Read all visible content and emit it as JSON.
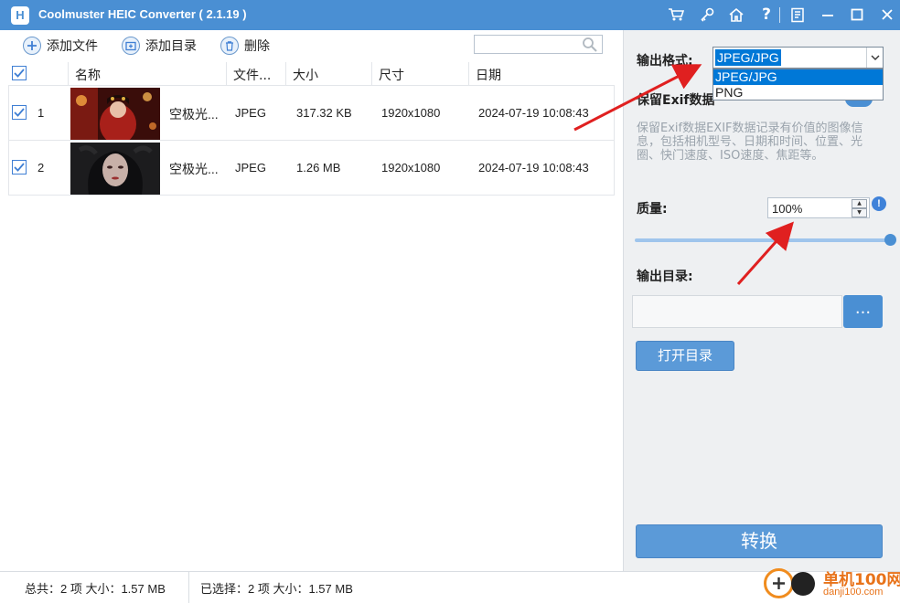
{
  "window": {
    "title": "Coolmuster HEIC Converter  ( 2.1.19 )",
    "logo_letter": "H",
    "titlebar_icons": [
      "cart-icon",
      "key-icon",
      "home-icon",
      "help-icon",
      "feedback-icon",
      "minimize-icon",
      "maximize-icon",
      "close-icon"
    ],
    "help_glyph": "?"
  },
  "toolbar": {
    "add_file": "添加文件",
    "add_folder": "添加目录",
    "delete": "删除",
    "search_placeholder": ""
  },
  "table": {
    "columns": [
      "名称",
      "文件...",
      "大小",
      "尺寸",
      "日期"
    ],
    "rows": [
      {
        "index": "1",
        "name": "空极光...",
        "type": "JPEG",
        "size": "317.32 KB",
        "dimensions": "1920x1080",
        "date": "2024-07-19 10:08:43",
        "checked": true
      },
      {
        "index": "2",
        "name": "空极光...",
        "type": "JPEG",
        "size": "1.26 MB",
        "dimensions": "1920x1080",
        "date": "2024-07-19 10:08:43",
        "checked": true
      }
    ]
  },
  "settings": {
    "output_format_label": "输出格式:",
    "output_format_value": "JPEG/JPG",
    "format_options": [
      "JPEG/JPG",
      "PNG"
    ],
    "exif_label": "保留Exif数据",
    "exif_desc": "保留Exif数据EXIF数据记录有价值的图像信息，包括相机型号、日期和时间、位置、光圈、快门速度、ISO速度、焦距等。",
    "quality_label": "质量:",
    "quality_value": "100%",
    "quality_percent": 100,
    "info_glyph": "!",
    "output_dir_label": "输出目录:",
    "output_dir_value": "",
    "browse_label": "...",
    "open_dir": "打开目录",
    "convert": "转换"
  },
  "status": {
    "total": "总共：2 项 大小：1.57 MB",
    "selected": "已选择：2 项 大小：1.57 MB"
  },
  "watermark": {
    "text": "单机100网",
    "url": "danji100.com"
  },
  "colors": {
    "accent": "#4a8fd3",
    "button": "#5b9ad8",
    "annotation_arrow": "#e02020",
    "watermark": "#e8731a"
  }
}
